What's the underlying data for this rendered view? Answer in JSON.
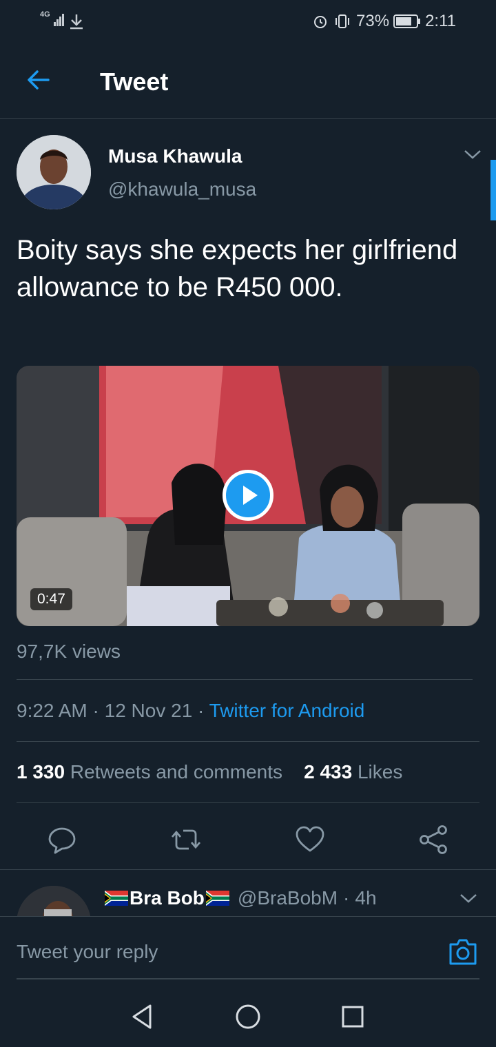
{
  "status_bar": {
    "network": "4G",
    "battery": "73%",
    "time": "2:11"
  },
  "header": {
    "title": "Tweet"
  },
  "tweet": {
    "author_name": "Musa Khawula",
    "author_handle": "@khawula_musa",
    "text": "Boity says she expects her girlfriend allowance to be R450 000.",
    "video_duration": "0:47",
    "views": "97,7K views",
    "time": "9:22 AM",
    "date": "12 Nov 21",
    "source": "Twitter for Android",
    "retweets_count": "1 330",
    "retweets_label": "Retweets and comments",
    "likes_count": "2 433",
    "likes_label": "Likes"
  },
  "reply_preview": {
    "name": "Bra Bob",
    "handle": "@BraBobM",
    "time": "4h"
  },
  "reply_box": {
    "placeholder": "Tweet your reply"
  },
  "colors": {
    "background": "#15202b",
    "accent": "#1d9bf0",
    "secondary_text": "#8899a6",
    "divider": "#38444d"
  },
  "icons": [
    "back-arrow-icon",
    "chevron-down-icon",
    "play-icon",
    "reply-icon",
    "retweet-icon",
    "like-icon",
    "share-icon",
    "camera-icon",
    "nav-back-icon",
    "nav-home-icon",
    "nav-recents-icon"
  ]
}
